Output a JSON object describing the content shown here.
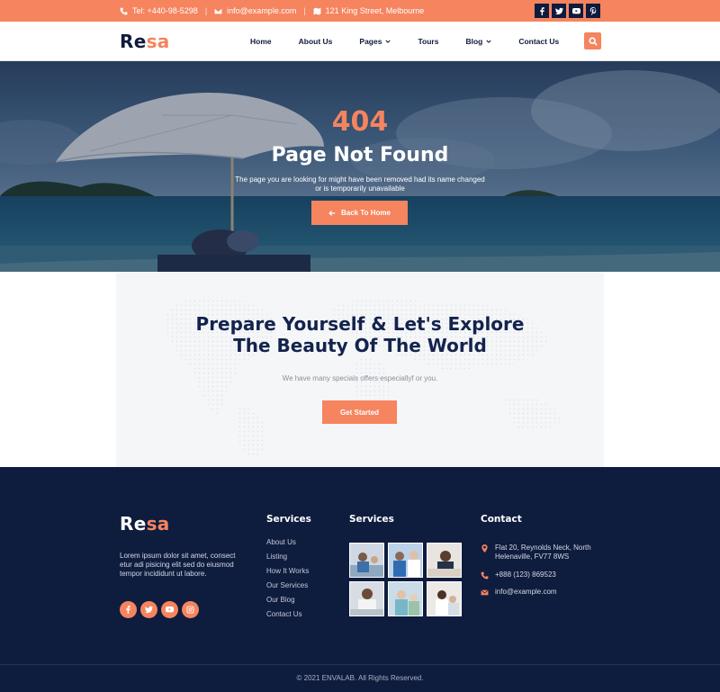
{
  "topbar": {
    "phone": "Tel: +440-98-5298",
    "email": "info@example.com",
    "address": "121 King Street, Melbourne",
    "separator": "|",
    "social_icons": [
      "facebook-icon",
      "twitter-icon",
      "youtube-icon",
      "pinterest-icon"
    ]
  },
  "brand": {
    "part1": "Re",
    "part2": "sa"
  },
  "nav": {
    "items": [
      "Home",
      "About Us",
      "Pages",
      "Tours",
      "Blog",
      "Contact Us"
    ]
  },
  "hero": {
    "code": "404",
    "title": "Page Not Found",
    "description": "The page you are looking for might have been removed had its name changed or is temporarily unavailable",
    "button": "Back To Home"
  },
  "explore": {
    "heading_line1": "Prepare Yourself & Let's Explore",
    "heading_line2": "The Beauty Of The World",
    "subtext": "We have many specials offers especiallyf or you.",
    "button": "Get Started"
  },
  "footer": {
    "about": "Lorem ipsum dolor sit amet, consect etur adi pisicing elit sed do eiusmod tempor incididunt ut labore.",
    "col1_title": "Services",
    "links": [
      "About Us",
      "Listing",
      "How It Works",
      "Our Services",
      "Our Blog",
      "Contact Us"
    ],
    "col2_title": "Services",
    "col3_title": "Contact",
    "address": "Flat 20, Reynolds Neck, North Helenaville, FV77 8WS",
    "phone": "+888 (123) 869523",
    "email": "info@example.com",
    "copyright": "© 2021 ENVALAB. All Rights Reserved."
  },
  "colors": {
    "accent": "#f5845f",
    "navy": "#0e1c3e"
  }
}
